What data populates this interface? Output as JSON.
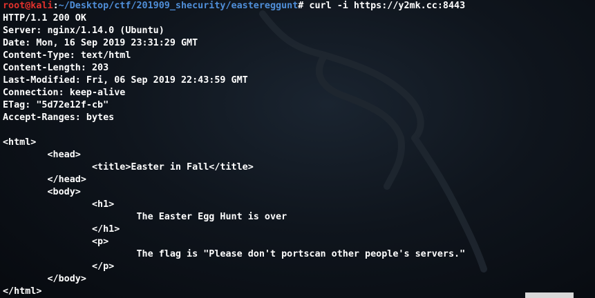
{
  "prompt": {
    "user_host": "root@kali",
    "separator": ":",
    "cwd": "~/Desktop/ctf/201909_shecurity/eastereggunt",
    "symbol": "#",
    "command": " curl -i https://y2mk.cc:8443"
  },
  "output_lines": [
    "HTTP/1.1 200 OK",
    "Server: nginx/1.14.0 (Ubuntu)",
    "Date: Mon, 16 Sep 2019 23:31:29 GMT",
    "Content-Type: text/html",
    "Content-Length: 203",
    "Last-Modified: Fri, 06 Sep 2019 22:43:59 GMT",
    "Connection: keep-alive",
    "ETag: \"5d72e12f-cb\"",
    "Accept-Ranges: bytes",
    "",
    "<html>",
    "        <head>",
    "                <title>Easter in Fall</title>",
    "        </head>",
    "        <body>",
    "                <h1>",
    "                        The Easter Egg Hunt is over",
    "                </h1>",
    "                <p>",
    "                        The flag is \"Please don't portscan other people's servers.\"",
    "                </p>",
    "        </body>",
    "</html>"
  ],
  "icons": {
    "background_logo": "kali-dragon-icon"
  },
  "colors": {
    "user_host": "#e0312c",
    "path": "#4f8ed8",
    "text": "#ffffff"
  }
}
